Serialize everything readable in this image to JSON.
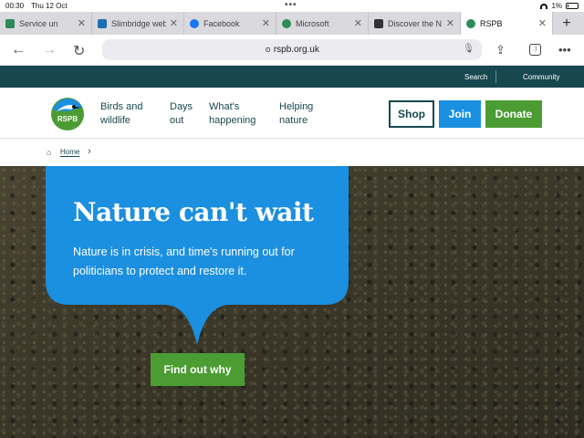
{
  "status": {
    "time": "00:30",
    "date": "Thu 12 Oct",
    "battery": "1%"
  },
  "tabs": [
    {
      "title": "Service un",
      "color": "#2e8b57",
      "active": false
    },
    {
      "title": "Slimbridge web",
      "color": "#1a6fb0",
      "active": false
    },
    {
      "title": "Facebook",
      "color": "#1877f2",
      "active": false
    },
    {
      "title": "Microsoft",
      "color": "#2e8b57",
      "active": false
    },
    {
      "title": "Discover the N",
      "color": "#333333",
      "active": false
    },
    {
      "title": "RSPB",
      "color": "#2e8b57",
      "active": true
    }
  ],
  "browser": {
    "url": "rspb.org.uk",
    "tab_count": ":)"
  },
  "utility": {
    "search": "Search",
    "community": "Community"
  },
  "logo": {
    "text": "RSPB"
  },
  "nav": [
    {
      "line1": "Birds and",
      "line2": "wildlife"
    },
    {
      "line1": "Days",
      "line2": "out"
    },
    {
      "line1": "What's",
      "line2": "happening"
    },
    {
      "line1": "Helping",
      "line2": "nature"
    }
  ],
  "buttons": {
    "shop": "Shop",
    "join": "Join",
    "donate": "Donate"
  },
  "breadcrumb": {
    "home": "Home"
  },
  "hero": {
    "title": "Nature can't wait",
    "text": "Nature is in crisis, and time's running out for politicians to protect and restore it.",
    "cta": "Find out why"
  },
  "colors": {
    "brand_teal": "#17484f",
    "brand_blue": "#1b8fe0",
    "brand_green": "#4b9d33"
  }
}
